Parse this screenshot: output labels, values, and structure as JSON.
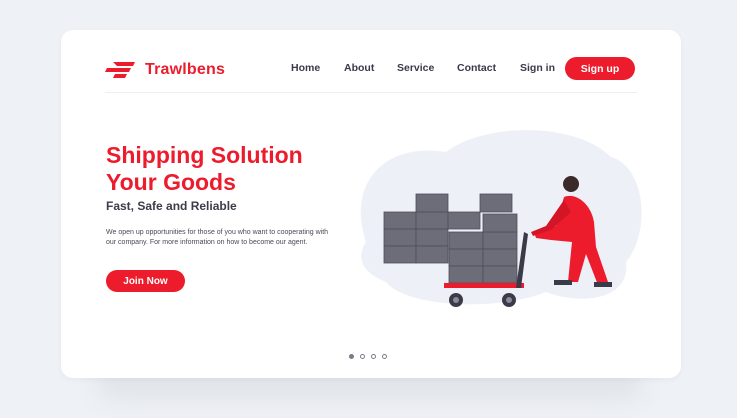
{
  "brand": {
    "name": "Trawlbens",
    "color": "#ec1c2d"
  },
  "nav": {
    "links": [
      "Home",
      "About",
      "Service",
      "Contact"
    ],
    "signin_label": "Sign in",
    "signup_label": "Sign up"
  },
  "hero": {
    "title_line1": "Shipping Solution",
    "title_line2": "Your Goods",
    "subtitle": "Fast, Safe and Reliable",
    "description": "We open up opportunities for those of you who want to cooperating with our company. For more information on how to become our agent.",
    "cta_label": "Join Now"
  },
  "carousel": {
    "slides": 4,
    "active_index": 0
  },
  "colors": {
    "accent": "#ec1c2d",
    "background": "#eef1f5",
    "text_dark": "#3a3a4a"
  }
}
